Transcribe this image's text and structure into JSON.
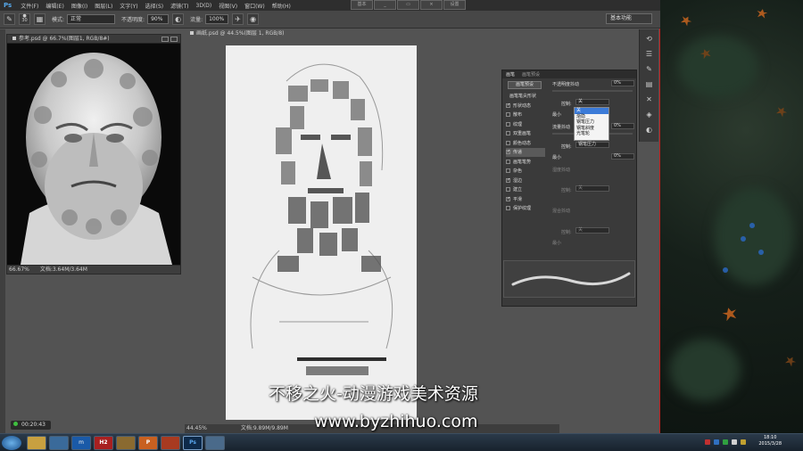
{
  "app": {
    "logo": "Ps",
    "menu": [
      "文件(F)",
      "编辑(E)",
      "图像(I)",
      "图层(L)",
      "文字(Y)",
      "选择(S)",
      "滤镜(T)",
      "3D(D)",
      "视图(V)",
      "窗口(W)",
      "帮助(H)"
    ],
    "window_buttons": [
      "基本",
      "",
      "",
      "",
      "设置"
    ],
    "options": {
      "brush_size": "30",
      "mode_label": "模式:",
      "mode_value": "正常",
      "opacity_label": "不透明度:",
      "opacity_value": "90%",
      "flow_label": "流量:",
      "flow_value": "100%"
    },
    "workspace": "基本功能"
  },
  "ref_doc": {
    "tab": "参考.psd @ 66.7%(图层1, RGB/8#)",
    "zoom": "66.67%",
    "doc_size": "文档:3.64M/3.64M"
  },
  "main_doc": {
    "tab": "画纸.psd @ 44.5%(图层 1, RGB/8)",
    "zoom": "44.45%",
    "doc_size": "文档:9.89M/9.89M"
  },
  "brush_panel": {
    "tabs": [
      "画笔",
      "画笔预设"
    ],
    "preset_button": "画笔预设",
    "tip_shape": "画笔笔尖形状",
    "items": [
      {
        "label": "形状动态",
        "checked": true
      },
      {
        "label": "散布",
        "checked": false
      },
      {
        "label": "纹理",
        "checked": false
      },
      {
        "label": "双重画笔",
        "checked": false
      },
      {
        "label": "颜色动态",
        "checked": false
      },
      {
        "label": "传递",
        "checked": true,
        "selected": true
      },
      {
        "label": "画笔笔势",
        "checked": false
      },
      {
        "label": "杂色",
        "checked": false
      },
      {
        "label": "湿边",
        "checked": true
      },
      {
        "label": "建立",
        "checked": false
      },
      {
        "label": "平滑",
        "checked": true
      },
      {
        "label": "保护纹理",
        "checked": false
      }
    ],
    "opacity_jitter_label": "不透明度抖动",
    "opacity_jitter_value": "0%",
    "control_label": "控制:",
    "control_value": "关",
    "min_label": "最小",
    "flow_jitter_label": "流量抖动",
    "flow_jitter_value": "0%",
    "control2_value": "钢笔压力",
    "min2_label": "最小",
    "min2_value": "0%",
    "wetness_jitter_label": "湿度抖动",
    "control3_value": "关",
    "mix_jitter_label": "混合抖动",
    "control4_value": "关",
    "min4_label": "最小",
    "dropdown_options": [
      "关",
      "渐隐",
      "钢笔压力",
      "钢笔斜度",
      "光笔轮"
    ],
    "dropdown_highlighted": 0
  },
  "timer": "00:20:43",
  "watermark": {
    "line1": "不移之火-动漫游戏美术资源",
    "line2": "www.byzhihuo.com"
  },
  "taskbar": {
    "apps": [
      "",
      "",
      "",
      "m",
      "H2",
      "",
      "P",
      "",
      "Ps",
      ""
    ],
    "time": "18:10",
    "date": "2015/3/28"
  }
}
